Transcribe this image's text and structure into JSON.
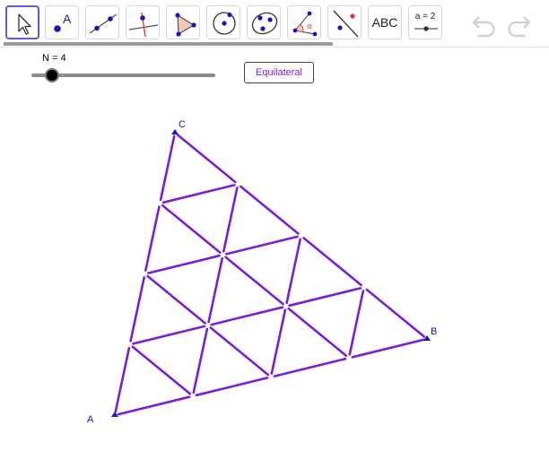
{
  "toolbar": {
    "tools": [
      {
        "name": "move-tool"
      },
      {
        "name": "point-tool",
        "glyph": "A"
      },
      {
        "name": "line-tool"
      },
      {
        "name": "perpendicular-line-tool"
      },
      {
        "name": "polygon-tool"
      },
      {
        "name": "circle-tool"
      },
      {
        "name": "conic-tool"
      },
      {
        "name": "angle-tool",
        "glyph": "α"
      },
      {
        "name": "reflect-tool"
      },
      {
        "name": "text-tool",
        "label": "ABC"
      },
      {
        "name": "slider-tool",
        "label": "a = 2"
      }
    ],
    "undo_icon": "undo-icon",
    "redo_icon": "redo-icon"
  },
  "slider": {
    "label": "N = 4",
    "value": 4
  },
  "button": {
    "label": "Equilateral"
  },
  "points": {
    "a": "A",
    "b": "B",
    "c": "C"
  },
  "colors": {
    "segments": "#7b1fd6",
    "points": "#1515c8",
    "active_border": "#6557d2"
  }
}
